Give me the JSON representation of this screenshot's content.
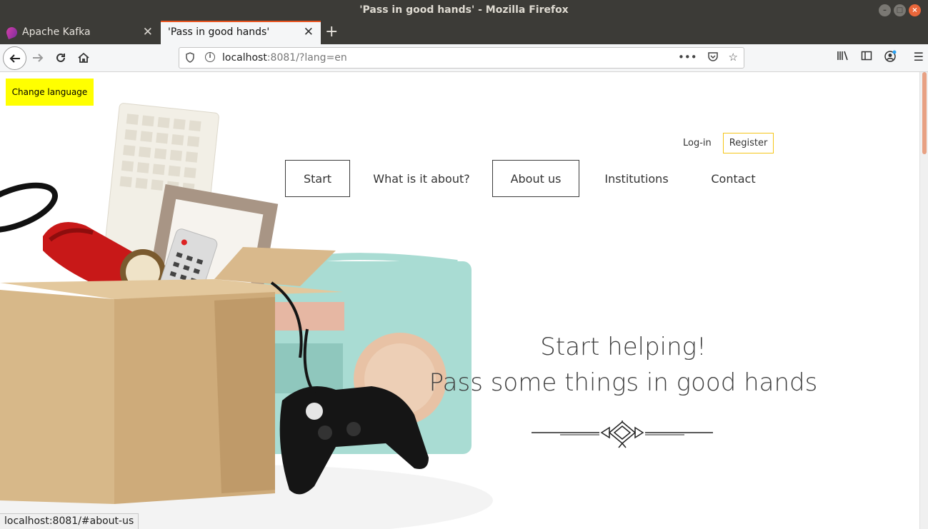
{
  "window": {
    "title": "'Pass in good hands' - Mozilla Firefox"
  },
  "tabs": [
    {
      "label": "Apache Kafka",
      "active": false
    },
    {
      "label": "'Pass in good hands'",
      "active": true
    }
  ],
  "urlbar": {
    "host": "localhost",
    "rest": ":8081/?lang=en"
  },
  "page": {
    "change_language": "Change language",
    "auth": {
      "login": "Log-in",
      "register": "Register"
    },
    "nav": [
      {
        "label": "Start",
        "boxed": true
      },
      {
        "label": "What is it about?",
        "boxed": false
      },
      {
        "label": "About us",
        "boxed": true
      },
      {
        "label": "Institutions",
        "boxed": false
      },
      {
        "label": "Contact",
        "boxed": false
      }
    ],
    "hero": {
      "line1": "Start helping!",
      "line2": "Pass some things in good hands"
    }
  },
  "statusbar": {
    "text": "localhost:8081/#about-us"
  },
  "colors": {
    "titlebar": "#3c3b37",
    "tab_accent": "#e95420",
    "change_language_bg": "#ffff00",
    "register_border": "#f5c518"
  }
}
